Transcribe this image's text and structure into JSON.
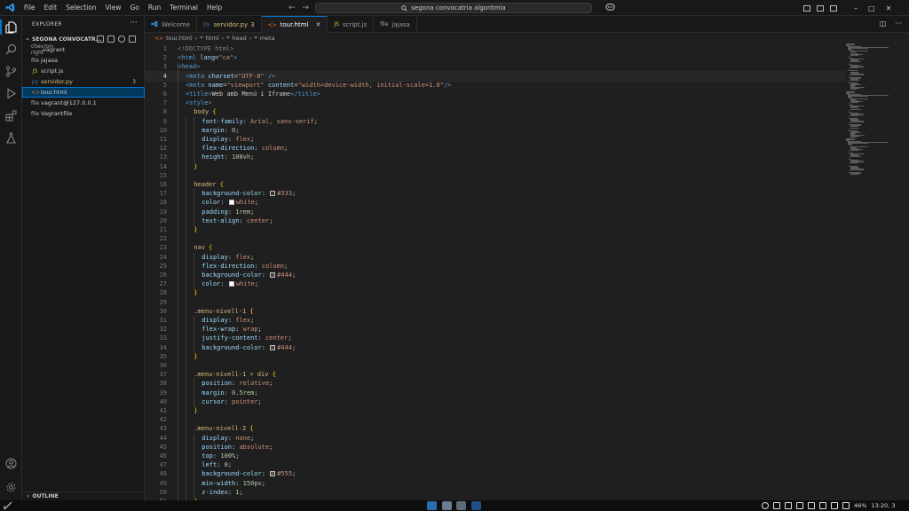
{
  "titlebar": {
    "menu": [
      "File",
      "Edit",
      "Selection",
      "View",
      "Go",
      "Run",
      "Terminal",
      "Help"
    ],
    "back_arrow": "←",
    "forward_arrow": "→",
    "search_text": "segona convocatria algoritmia",
    "window_controls": [
      "–",
      "□",
      "✕"
    ]
  },
  "sidebar": {
    "title": "EXPLORER",
    "more": "···",
    "folder": "SEGONA CONVOCATR...",
    "items": [
      {
        "label": ".vagrant",
        "icon": "chevron-right",
        "color": "#cccccc",
        "badge": ""
      },
      {
        "label": "jajasa",
        "icon": "file",
        "color": "#cccccc",
        "badge": ""
      },
      {
        "label": "script.js",
        "icon": "JS",
        "color": "#cccccc",
        "badge": ""
      },
      {
        "label": "servidor.py",
        "icon": "py",
        "color": "#d7ba7d",
        "badge": "3"
      },
      {
        "label": "tour.html",
        "icon": "<>",
        "color": "#cccccc",
        "badge": ""
      },
      {
        "label": "vagrant@127.0.0.1",
        "icon": "file",
        "color": "#cccccc",
        "badge": ""
      },
      {
        "label": "Vagrantfile",
        "icon": "file",
        "color": "#cccccc",
        "badge": ""
      }
    ],
    "outline": "OUTLINE"
  },
  "tabs": [
    {
      "label": "Welcome",
      "icon": "vscode",
      "modified": "",
      "active": false
    },
    {
      "label": "servidor.py",
      "icon": "py",
      "modified": "3",
      "active": false
    },
    {
      "label": "tour.html",
      "icon": "<>",
      "modified": "",
      "active": true
    },
    {
      "label": "script.js",
      "icon": "JS",
      "modified": "",
      "active": false
    },
    {
      "label": "jajasa",
      "icon": "file",
      "modified": "",
      "active": false
    }
  ],
  "breadcrumb": [
    "tour.html",
    "html",
    "head",
    "meta"
  ],
  "editor": {
    "current_line": 4,
    "lines": [
      {
        "n": "1",
        "i": 0,
        "t": [
          [
            "c-doc",
            "<!DOCTYPE html>"
          ]
        ]
      },
      {
        "n": "2",
        "i": 0,
        "t": [
          [
            "c-tag",
            "<html "
          ],
          [
            "c-attr",
            "lang"
          ],
          [
            "c-txt",
            "="
          ],
          [
            "c-str",
            "\"ca\""
          ],
          [
            "c-tag",
            ">"
          ]
        ]
      },
      {
        "n": "3",
        "i": 0,
        "t": [
          [
            "c-tag",
            "<head>"
          ]
        ]
      },
      {
        "n": "4",
        "i": 1,
        "t": [
          [
            "c-tag",
            "<meta "
          ],
          [
            "c-attr",
            "charset"
          ],
          [
            "c-txt",
            "="
          ],
          [
            "c-str",
            "\"UTF-8\""
          ],
          [
            "c-tag",
            " />"
          ]
        ]
      },
      {
        "n": "5",
        "i": 1,
        "t": [
          [
            "c-tag",
            "<meta "
          ],
          [
            "c-attr",
            "name"
          ],
          [
            "c-txt",
            "="
          ],
          [
            "c-str",
            "\"viewport\""
          ],
          [
            "c-attr",
            " content"
          ],
          [
            "c-txt",
            "="
          ],
          [
            "c-str",
            "\"width=device-width, initial-scale=1.0\""
          ],
          [
            "c-tag",
            "/>"
          ]
        ]
      },
      {
        "n": "6",
        "i": 1,
        "t": [
          [
            "c-tag",
            "<title>"
          ],
          [
            "c-txt",
            "Web amb Menú i Iframe"
          ],
          [
            "c-tag",
            "</title>"
          ]
        ]
      },
      {
        "n": "7",
        "i": 1,
        "t": [
          [
            "c-tag",
            "<style>"
          ]
        ]
      },
      {
        "n": "8",
        "i": 2,
        "t": [
          [
            "c-sel",
            "body "
          ],
          [
            "c-brace",
            "{"
          ]
        ]
      },
      {
        "n": "9",
        "i": 3,
        "t": [
          [
            "c-prop",
            "font-family"
          ],
          [
            "c-txt",
            ": "
          ],
          [
            "c-val",
            "Arial, sans-serif"
          ],
          [
            "c-txt",
            ";"
          ]
        ]
      },
      {
        "n": "10",
        "i": 3,
        "t": [
          [
            "c-prop",
            "margin"
          ],
          [
            "c-txt",
            ": "
          ],
          [
            "c-num",
            "0"
          ],
          [
            "c-txt",
            ";"
          ]
        ]
      },
      {
        "n": "11",
        "i": 3,
        "t": [
          [
            "c-prop",
            "display"
          ],
          [
            "c-txt",
            ": "
          ],
          [
            "c-val",
            "flex"
          ],
          [
            "c-txt",
            ";"
          ]
        ]
      },
      {
        "n": "12",
        "i": 3,
        "t": [
          [
            "c-prop",
            "flex-direction"
          ],
          [
            "c-txt",
            ": "
          ],
          [
            "c-val",
            "column"
          ],
          [
            "c-txt",
            ";"
          ]
        ]
      },
      {
        "n": "13",
        "i": 3,
        "t": [
          [
            "c-prop",
            "height"
          ],
          [
            "c-txt",
            ": "
          ],
          [
            "c-num",
            "100vh"
          ],
          [
            "c-txt",
            ";"
          ]
        ]
      },
      {
        "n": "14",
        "i": 2,
        "t": [
          [
            "c-brace",
            "}"
          ]
        ]
      },
      {
        "n": "15",
        "i": 0,
        "t": []
      },
      {
        "n": "16",
        "i": 2,
        "t": [
          [
            "c-sel",
            "header "
          ],
          [
            "c-brace",
            "{"
          ]
        ]
      },
      {
        "n": "17",
        "i": 3,
        "t": [
          [
            "c-prop",
            "background-color"
          ],
          [
            "c-txt",
            ": "
          ],
          [
            "swatch",
            "#333333"
          ],
          [
            "c-val",
            "#333"
          ],
          [
            "c-txt",
            ";"
          ]
        ]
      },
      {
        "n": "18",
        "i": 3,
        "t": [
          [
            "c-prop",
            "color"
          ],
          [
            "c-txt",
            ": "
          ],
          [
            "swatch",
            "#ffffff"
          ],
          [
            "c-val",
            "white"
          ],
          [
            "c-txt",
            ";"
          ]
        ]
      },
      {
        "n": "19",
        "i": 3,
        "t": [
          [
            "c-prop",
            "padding"
          ],
          [
            "c-txt",
            ": "
          ],
          [
            "c-num",
            "1rem"
          ],
          [
            "c-txt",
            ";"
          ]
        ]
      },
      {
        "n": "20",
        "i": 3,
        "t": [
          [
            "c-prop",
            "text-align"
          ],
          [
            "c-txt",
            ": "
          ],
          [
            "c-val",
            "center"
          ],
          [
            "c-txt",
            ";"
          ]
        ]
      },
      {
        "n": "21",
        "i": 2,
        "t": [
          [
            "c-brace",
            "}"
          ]
        ]
      },
      {
        "n": "22",
        "i": 0,
        "t": []
      },
      {
        "n": "23",
        "i": 2,
        "t": [
          [
            "c-sel",
            "nav "
          ],
          [
            "c-brace",
            "{"
          ]
        ]
      },
      {
        "n": "24",
        "i": 3,
        "t": [
          [
            "c-prop",
            "display"
          ],
          [
            "c-txt",
            ": "
          ],
          [
            "c-val",
            "flex"
          ],
          [
            "c-txt",
            ";"
          ]
        ]
      },
      {
        "n": "25",
        "i": 3,
        "t": [
          [
            "c-prop",
            "flex-direction"
          ],
          [
            "c-txt",
            ": "
          ],
          [
            "c-val",
            "column"
          ],
          [
            "c-txt",
            ";"
          ]
        ]
      },
      {
        "n": "26",
        "i": 3,
        "t": [
          [
            "c-prop",
            "background-color"
          ],
          [
            "c-txt",
            ": "
          ],
          [
            "swatch",
            "#444444"
          ],
          [
            "c-val",
            "#444"
          ],
          [
            "c-txt",
            ";"
          ]
        ]
      },
      {
        "n": "27",
        "i": 3,
        "t": [
          [
            "c-prop",
            "color"
          ],
          [
            "c-txt",
            ": "
          ],
          [
            "swatch",
            "#ffffff"
          ],
          [
            "c-val",
            "white"
          ],
          [
            "c-txt",
            ";"
          ]
        ]
      },
      {
        "n": "28",
        "i": 2,
        "t": [
          [
            "c-brace",
            "}"
          ]
        ]
      },
      {
        "n": "29",
        "i": 0,
        "t": []
      },
      {
        "n": "30",
        "i": 2,
        "t": [
          [
            "c-sel",
            ".menu-nivell-1 "
          ],
          [
            "c-brace",
            "{"
          ]
        ]
      },
      {
        "n": "31",
        "i": 3,
        "t": [
          [
            "c-prop",
            "display"
          ],
          [
            "c-txt",
            ": "
          ],
          [
            "c-val",
            "flex"
          ],
          [
            "c-txt",
            ";"
          ]
        ]
      },
      {
        "n": "32",
        "i": 3,
        "t": [
          [
            "c-prop",
            "flex-wrap"
          ],
          [
            "c-txt",
            ": "
          ],
          [
            "c-val",
            "wrap"
          ],
          [
            "c-txt",
            ";"
          ]
        ]
      },
      {
        "n": "33",
        "i": 3,
        "t": [
          [
            "c-prop",
            "justify-content"
          ],
          [
            "c-txt",
            ": "
          ],
          [
            "c-val",
            "center"
          ],
          [
            "c-txt",
            ";"
          ]
        ]
      },
      {
        "n": "34",
        "i": 3,
        "t": [
          [
            "c-prop",
            "background-color"
          ],
          [
            "c-txt",
            ": "
          ],
          [
            "swatch",
            "#444444"
          ],
          [
            "c-val",
            "#444"
          ],
          [
            "c-txt",
            ";"
          ]
        ]
      },
      {
        "n": "35",
        "i": 2,
        "t": [
          [
            "c-brace",
            "}"
          ]
        ]
      },
      {
        "n": "36",
        "i": 0,
        "t": []
      },
      {
        "n": "37",
        "i": 2,
        "t": [
          [
            "c-sel",
            ".menu-nivell-1 > div "
          ],
          [
            "c-brace",
            "{"
          ]
        ]
      },
      {
        "n": "38",
        "i": 3,
        "t": [
          [
            "c-prop",
            "position"
          ],
          [
            "c-txt",
            ": "
          ],
          [
            "c-val",
            "relative"
          ],
          [
            "c-txt",
            ";"
          ]
        ]
      },
      {
        "n": "39",
        "i": 3,
        "t": [
          [
            "c-prop",
            "margin"
          ],
          [
            "c-txt",
            ": "
          ],
          [
            "c-num",
            "0.5rem"
          ],
          [
            "c-txt",
            ";"
          ]
        ]
      },
      {
        "n": "40",
        "i": 3,
        "t": [
          [
            "c-prop",
            "cursor"
          ],
          [
            "c-txt",
            ": "
          ],
          [
            "c-val",
            "pointer"
          ],
          [
            "c-txt",
            ";"
          ]
        ]
      },
      {
        "n": "41",
        "i": 2,
        "t": [
          [
            "c-brace",
            "}"
          ]
        ]
      },
      {
        "n": "42",
        "i": 0,
        "t": []
      },
      {
        "n": "43",
        "i": 2,
        "t": [
          [
            "c-sel",
            ".menu-nivell-2 "
          ],
          [
            "c-brace",
            "{"
          ]
        ]
      },
      {
        "n": "44",
        "i": 3,
        "t": [
          [
            "c-prop",
            "display"
          ],
          [
            "c-txt",
            ": "
          ],
          [
            "c-val",
            "none"
          ],
          [
            "c-txt",
            ";"
          ]
        ]
      },
      {
        "n": "45",
        "i": 3,
        "t": [
          [
            "c-prop",
            "position"
          ],
          [
            "c-txt",
            ": "
          ],
          [
            "c-val",
            "absolute"
          ],
          [
            "c-txt",
            ";"
          ]
        ]
      },
      {
        "n": "46",
        "i": 3,
        "t": [
          [
            "c-prop",
            "top"
          ],
          [
            "c-txt",
            ": "
          ],
          [
            "c-num",
            "100%"
          ],
          [
            "c-txt",
            ";"
          ]
        ]
      },
      {
        "n": "47",
        "i": 3,
        "t": [
          [
            "c-prop",
            "left"
          ],
          [
            "c-txt",
            ": "
          ],
          [
            "c-num",
            "0"
          ],
          [
            "c-txt",
            ";"
          ]
        ]
      },
      {
        "n": "48",
        "i": 3,
        "t": [
          [
            "c-prop",
            "background-color"
          ],
          [
            "c-txt",
            ": "
          ],
          [
            "swatch",
            "#555555"
          ],
          [
            "c-val",
            "#555"
          ],
          [
            "c-txt",
            ";"
          ]
        ]
      },
      {
        "n": "49",
        "i": 3,
        "t": [
          [
            "c-prop",
            "min-width"
          ],
          [
            "c-txt",
            ": "
          ],
          [
            "c-num",
            "150px"
          ],
          [
            "c-txt",
            ";"
          ]
        ]
      },
      {
        "n": "50",
        "i": 3,
        "t": [
          [
            "c-prop",
            "z-index"
          ],
          [
            "c-txt",
            ": "
          ],
          [
            "c-num",
            "1"
          ],
          [
            "c-txt",
            ";"
          ]
        ]
      },
      {
        "n": "51",
        "i": 2,
        "t": [
          [
            "c-brace",
            "}"
          ]
        ]
      }
    ]
  },
  "taskbar": {
    "battery": "46%",
    "time": "13:20, 3"
  },
  "colors": {
    "accent": "#0078d4",
    "editor_bg": "#1f1f1f",
    "sidebar_bg": "#181818",
    "selection": "#04395e",
    "modified": "#d7ba7d"
  }
}
